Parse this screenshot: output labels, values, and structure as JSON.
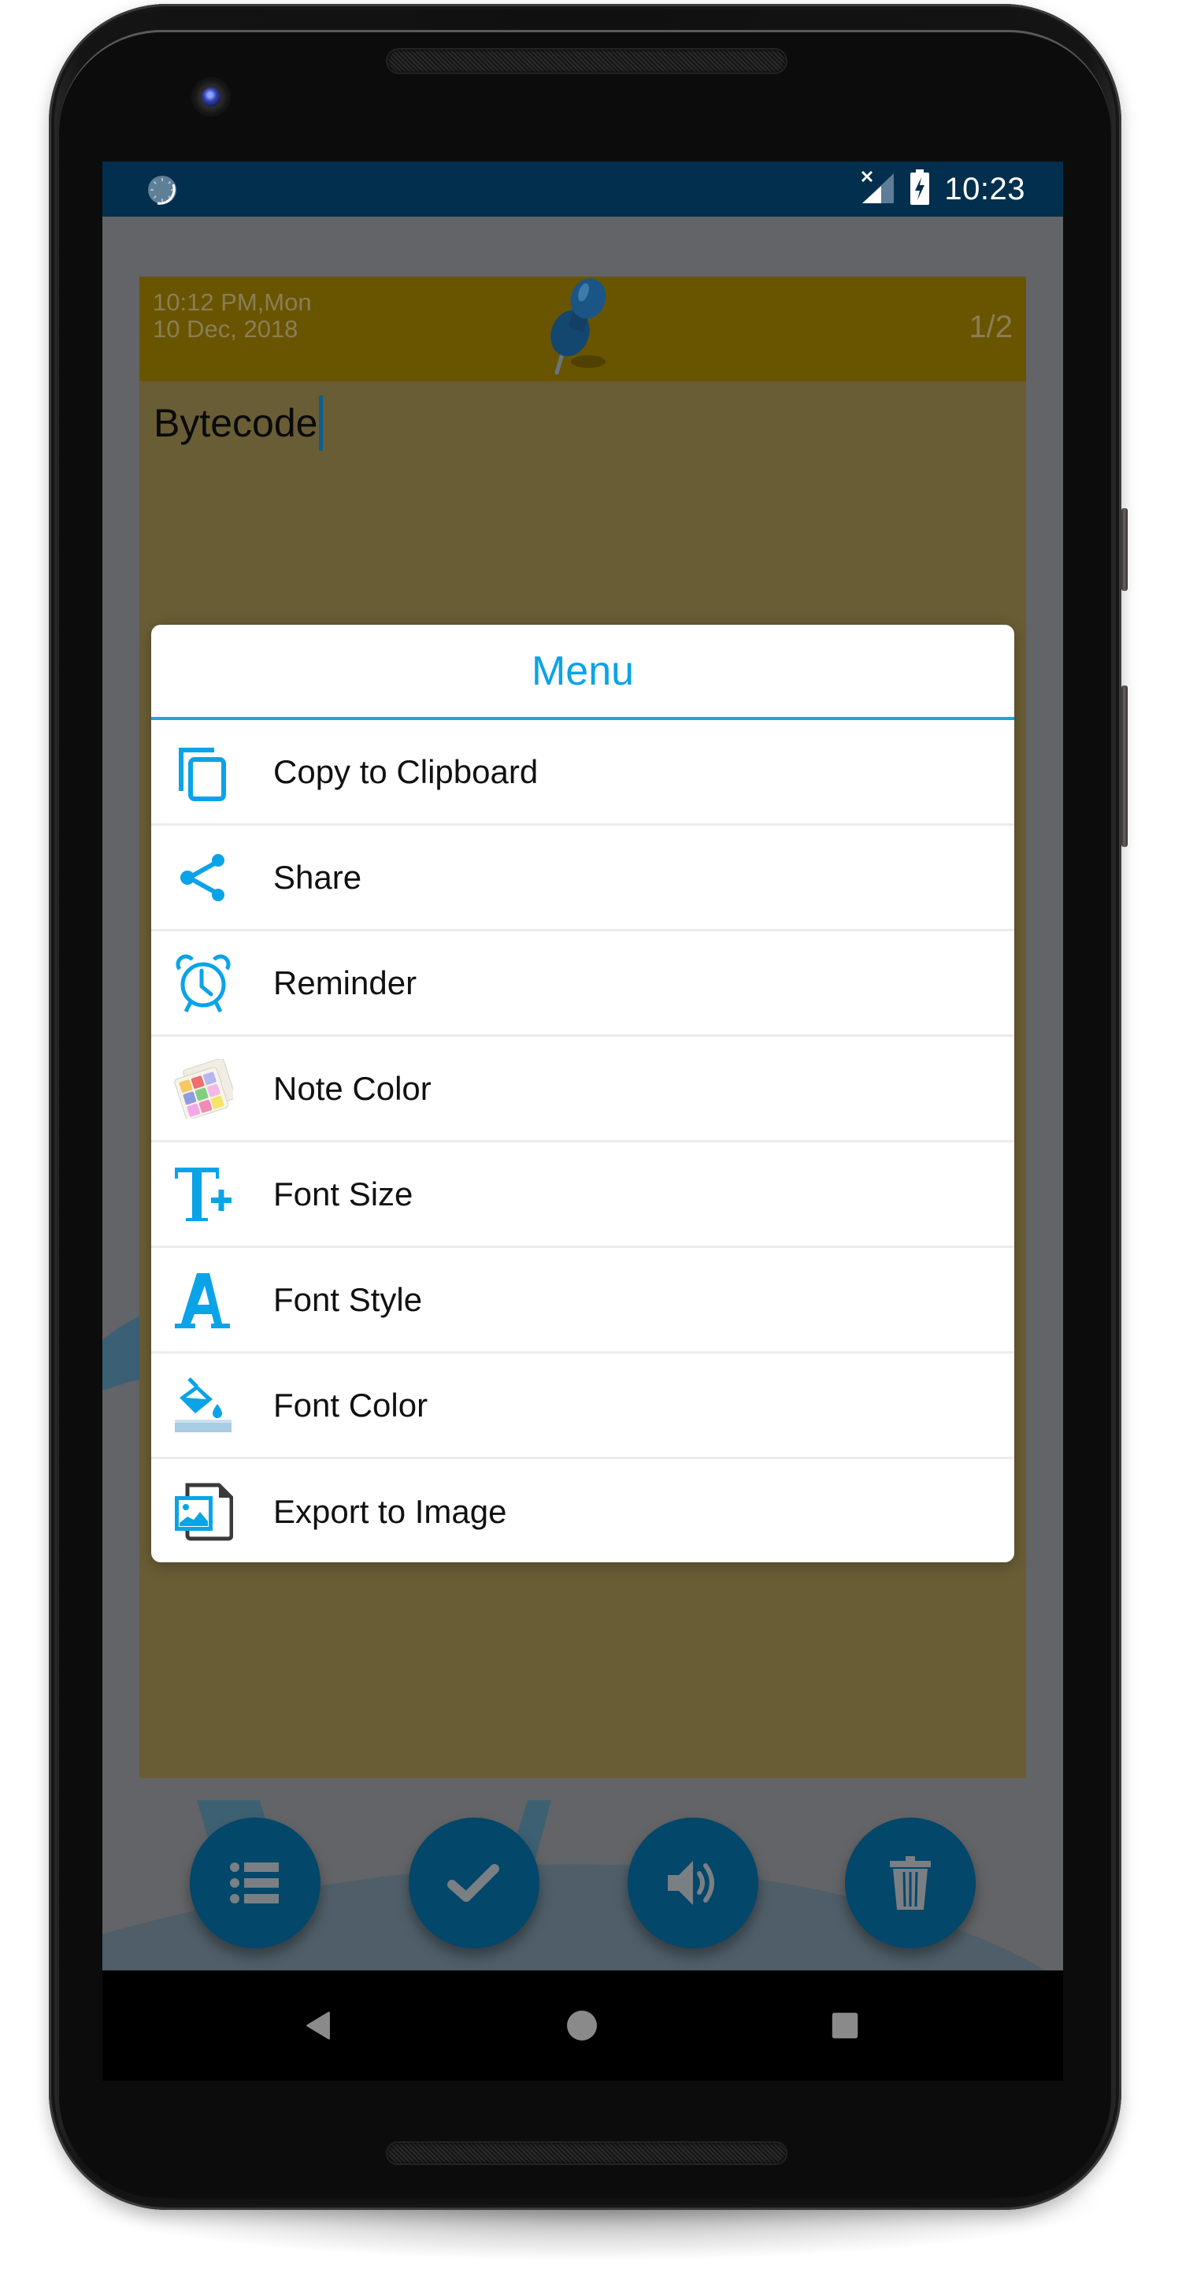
{
  "status_bar": {
    "time": "10:23",
    "icons": [
      "sync-icon",
      "no-sim-signal-icon",
      "battery-charging-icon"
    ]
  },
  "note": {
    "timestamp_line1": "10:12 PM,Mon",
    "timestamp_line2": "10 Dec, 2018",
    "page_indicator": "1/2",
    "text": "Bytecode",
    "header_color": "#695500",
    "body_color": "#695d35",
    "pin_icon": "pushpin-icon"
  },
  "menu": {
    "title": "Menu",
    "accent_color": "#0aa3e8",
    "items": [
      {
        "label": "Copy to Clipboard",
        "icon": "copy-icon"
      },
      {
        "label": "Share",
        "icon": "share-icon"
      },
      {
        "label": "Reminder",
        "icon": "alarm-clock-icon"
      },
      {
        "label": "Note Color",
        "icon": "color-palette-icon"
      },
      {
        "label": "Font Size",
        "icon": "text-size-plus-icon"
      },
      {
        "label": "Font Style",
        "icon": "font-style-icon"
      },
      {
        "label": "Font Color",
        "icon": "paint-bucket-icon"
      },
      {
        "label": "Export to Image",
        "icon": "export-image-icon"
      }
    ]
  },
  "fab_bar": {
    "color": "#03476a",
    "buttons": [
      {
        "icon": "list-icon"
      },
      {
        "icon": "check-icon"
      },
      {
        "icon": "speaker-icon"
      },
      {
        "icon": "trash-icon"
      }
    ]
  },
  "nav_bar": {
    "buttons": [
      {
        "icon": "back-icon"
      },
      {
        "icon": "home-icon"
      },
      {
        "icon": "recents-icon"
      }
    ]
  }
}
